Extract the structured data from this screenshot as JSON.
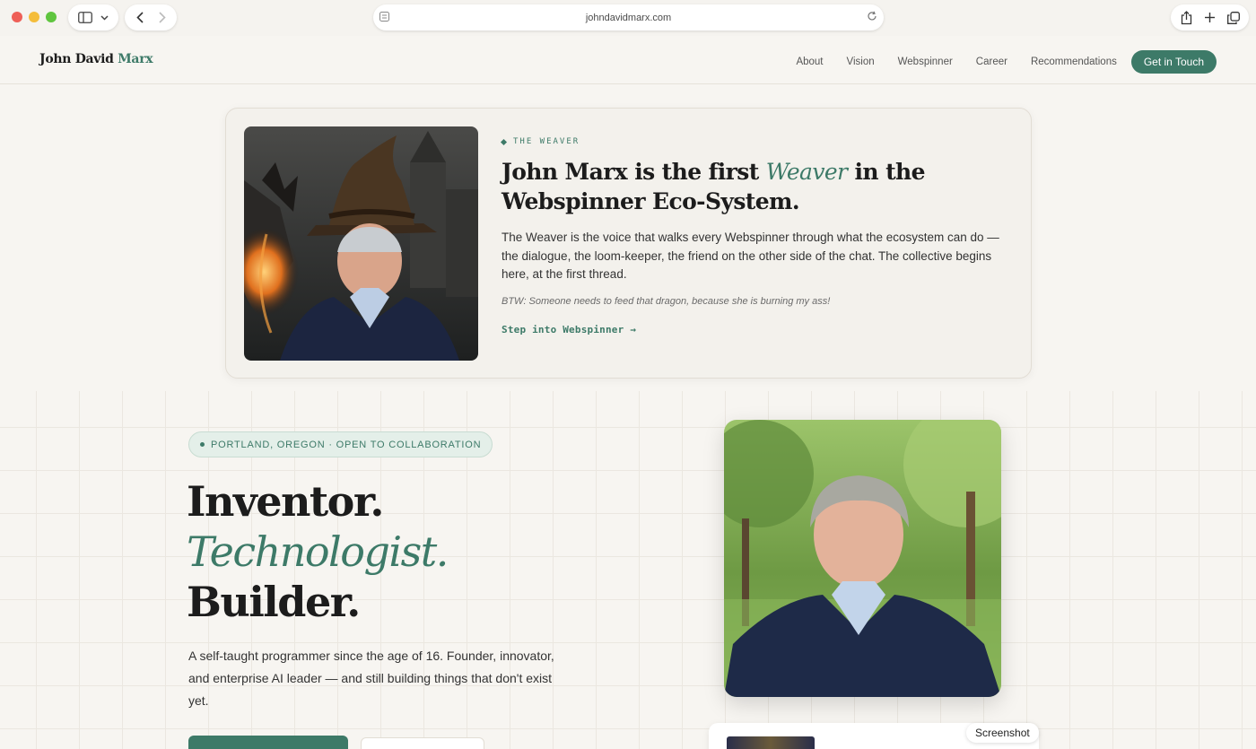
{
  "browser": {
    "url": "johndavidmarx.com",
    "icons": [
      "sidebar-icon",
      "chevron-down-icon",
      "back-icon",
      "forward-icon",
      "page-icon",
      "reload-icon",
      "share-icon",
      "new-tab-icon",
      "tabs-icon"
    ]
  },
  "header": {
    "brand_first": "John David ",
    "brand_accent": "Marx",
    "nav": [
      "About",
      "Vision",
      "Webspinner",
      "Career",
      "Recommendations"
    ],
    "cta": "Get in Touch"
  },
  "weaver": {
    "eyebrow": "THE WEAVER",
    "title_before": "John Marx is the first ",
    "title_accent": "Weaver",
    "title_after": " in the Webspinner Eco-System.",
    "body": "The Weaver is the voice that walks every Webspinner through what the ecosystem can do — the dialogue, the loom-keeper, the friend on the other side of the chat. The collective begins here, at the first thread.",
    "note": "BTW: Someone needs to feed that dragon, because she is burning my ass!",
    "link": "Step into Webspinner →"
  },
  "hero": {
    "location": "PORTLAND, OREGON · OPEN TO COLLABORATION",
    "line1": "Inventor.",
    "line2": "Technologist.",
    "line3": "Builder.",
    "description": "A self-taught programmer since the age of 16. Founder, innovator, and enterprise AI leader — and still building things that don't exist yet."
  },
  "tooltip": "Screenshot",
  "colors": {
    "accent": "#3d7a68",
    "background": "#f7f5f1",
    "text": "#1c1c1c"
  }
}
